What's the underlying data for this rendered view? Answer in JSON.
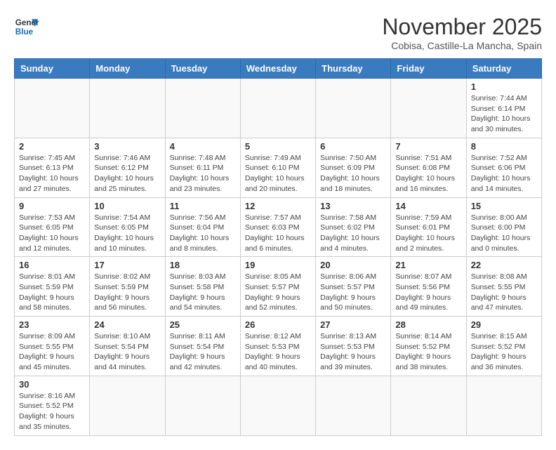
{
  "header": {
    "logo_line1": "General",
    "logo_line2": "Blue",
    "month_year": "November 2025",
    "location": "Cobisa, Castille-La Mancha, Spain"
  },
  "days_of_week": [
    "Sunday",
    "Monday",
    "Tuesday",
    "Wednesday",
    "Thursday",
    "Friday",
    "Saturday"
  ],
  "weeks": [
    [
      {
        "day": "",
        "info": ""
      },
      {
        "day": "",
        "info": ""
      },
      {
        "day": "",
        "info": ""
      },
      {
        "day": "",
        "info": ""
      },
      {
        "day": "",
        "info": ""
      },
      {
        "day": "",
        "info": ""
      },
      {
        "day": "1",
        "info": "Sunrise: 7:44 AM\nSunset: 6:14 PM\nDaylight: 10 hours\nand 30 minutes."
      }
    ],
    [
      {
        "day": "2",
        "info": "Sunrise: 7:45 AM\nSunset: 6:13 PM\nDaylight: 10 hours\nand 27 minutes."
      },
      {
        "day": "3",
        "info": "Sunrise: 7:46 AM\nSunset: 6:12 PM\nDaylight: 10 hours\nand 25 minutes."
      },
      {
        "day": "4",
        "info": "Sunrise: 7:48 AM\nSunset: 6:11 PM\nDaylight: 10 hours\nand 23 minutes."
      },
      {
        "day": "5",
        "info": "Sunrise: 7:49 AM\nSunset: 6:10 PM\nDaylight: 10 hours\nand 20 minutes."
      },
      {
        "day": "6",
        "info": "Sunrise: 7:50 AM\nSunset: 6:09 PM\nDaylight: 10 hours\nand 18 minutes."
      },
      {
        "day": "7",
        "info": "Sunrise: 7:51 AM\nSunset: 6:08 PM\nDaylight: 10 hours\nand 16 minutes."
      },
      {
        "day": "8",
        "info": "Sunrise: 7:52 AM\nSunset: 6:06 PM\nDaylight: 10 hours\nand 14 minutes."
      }
    ],
    [
      {
        "day": "9",
        "info": "Sunrise: 7:53 AM\nSunset: 6:05 PM\nDaylight: 10 hours\nand 12 minutes."
      },
      {
        "day": "10",
        "info": "Sunrise: 7:54 AM\nSunset: 6:05 PM\nDaylight: 10 hours\nand 10 minutes."
      },
      {
        "day": "11",
        "info": "Sunrise: 7:56 AM\nSunset: 6:04 PM\nDaylight: 10 hours\nand 8 minutes."
      },
      {
        "day": "12",
        "info": "Sunrise: 7:57 AM\nSunset: 6:03 PM\nDaylight: 10 hours\nand 6 minutes."
      },
      {
        "day": "13",
        "info": "Sunrise: 7:58 AM\nSunset: 6:02 PM\nDaylight: 10 hours\nand 4 minutes."
      },
      {
        "day": "14",
        "info": "Sunrise: 7:59 AM\nSunset: 6:01 PM\nDaylight: 10 hours\nand 2 minutes."
      },
      {
        "day": "15",
        "info": "Sunrise: 8:00 AM\nSunset: 6:00 PM\nDaylight: 10 hours\nand 0 minutes."
      }
    ],
    [
      {
        "day": "16",
        "info": "Sunrise: 8:01 AM\nSunset: 5:59 PM\nDaylight: 9 hours\nand 58 minutes."
      },
      {
        "day": "17",
        "info": "Sunrise: 8:02 AM\nSunset: 5:59 PM\nDaylight: 9 hours\nand 56 minutes."
      },
      {
        "day": "18",
        "info": "Sunrise: 8:03 AM\nSunset: 5:58 PM\nDaylight: 9 hours\nand 54 minutes."
      },
      {
        "day": "19",
        "info": "Sunrise: 8:05 AM\nSunset: 5:57 PM\nDaylight: 9 hours\nand 52 minutes."
      },
      {
        "day": "20",
        "info": "Sunrise: 8:06 AM\nSunset: 5:57 PM\nDaylight: 9 hours\nand 50 minutes."
      },
      {
        "day": "21",
        "info": "Sunrise: 8:07 AM\nSunset: 5:56 PM\nDaylight: 9 hours\nand 49 minutes."
      },
      {
        "day": "22",
        "info": "Sunrise: 8:08 AM\nSunset: 5:55 PM\nDaylight: 9 hours\nand 47 minutes."
      }
    ],
    [
      {
        "day": "23",
        "info": "Sunrise: 8:09 AM\nSunset: 5:55 PM\nDaylight: 9 hours\nand 45 minutes."
      },
      {
        "day": "24",
        "info": "Sunrise: 8:10 AM\nSunset: 5:54 PM\nDaylight: 9 hours\nand 44 minutes."
      },
      {
        "day": "25",
        "info": "Sunrise: 8:11 AM\nSunset: 5:54 PM\nDaylight: 9 hours\nand 42 minutes."
      },
      {
        "day": "26",
        "info": "Sunrise: 8:12 AM\nSunset: 5:53 PM\nDaylight: 9 hours\nand 40 minutes."
      },
      {
        "day": "27",
        "info": "Sunrise: 8:13 AM\nSunset: 5:53 PM\nDaylight: 9 hours\nand 39 minutes."
      },
      {
        "day": "28",
        "info": "Sunrise: 8:14 AM\nSunset: 5:52 PM\nDaylight: 9 hours\nand 38 minutes."
      },
      {
        "day": "29",
        "info": "Sunrise: 8:15 AM\nSunset: 5:52 PM\nDaylight: 9 hours\nand 36 minutes."
      }
    ],
    [
      {
        "day": "30",
        "info": "Sunrise: 8:16 AM\nSunset: 5:52 PM\nDaylight: 9 hours\nand 35 minutes."
      },
      {
        "day": "",
        "info": ""
      },
      {
        "day": "",
        "info": ""
      },
      {
        "day": "",
        "info": ""
      },
      {
        "day": "",
        "info": ""
      },
      {
        "day": "",
        "info": ""
      },
      {
        "day": "",
        "info": ""
      }
    ]
  ]
}
